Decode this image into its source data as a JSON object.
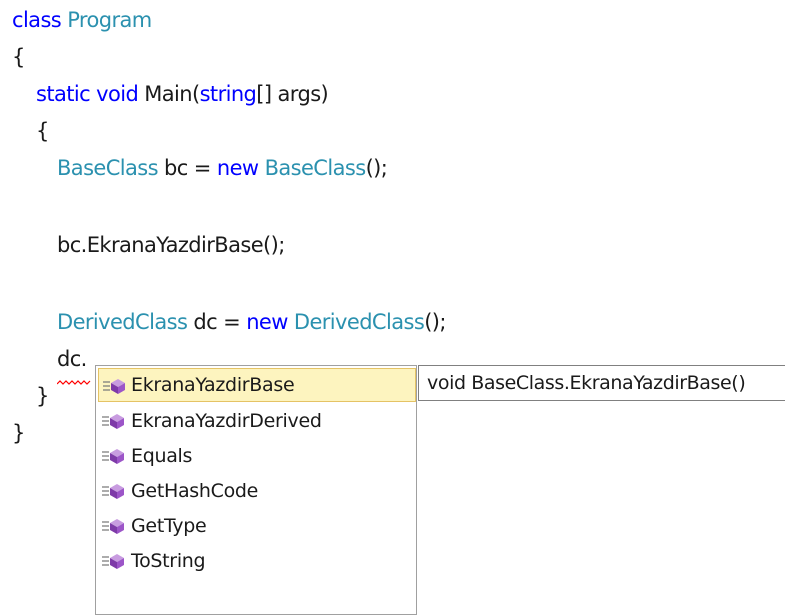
{
  "code": {
    "line1": {
      "keyword": "class",
      "name": "Program"
    },
    "line2": {
      "brace": "{"
    },
    "line3": {
      "kw1": "static",
      "kw2": "void",
      "name": "Main(",
      "param_type": "string",
      "rest": "[] args)"
    },
    "line4": {
      "brace": "{"
    },
    "line5": {
      "type": "BaseClass",
      "var": " bc = ",
      "kw": "new",
      "ctor": " BaseClass",
      "rest": "();"
    },
    "line6": {
      "text": "bc.EkranaYazdirBase();"
    },
    "line7": {
      "type": "DerivedClass",
      "var": " dc = ",
      "kw": "new",
      "ctor": " DerivedClass",
      "rest": "();"
    },
    "line8": {
      "text": "dc."
    },
    "line9": {
      "brace": "}"
    },
    "line10": {
      "brace": "}"
    }
  },
  "completion_list": {
    "items": [
      {
        "label": "EkranaYazdirBase",
        "icon": "method-icon",
        "selected": true
      },
      {
        "label": "EkranaYazdirDerived",
        "icon": "method-icon"
      },
      {
        "label": "Equals",
        "icon": "method-icon"
      },
      {
        "label": "GetHashCode",
        "icon": "method-icon"
      },
      {
        "label": "GetType",
        "icon": "method-icon"
      },
      {
        "label": "ToString",
        "icon": "method-icon"
      }
    ]
  },
  "tooltip": {
    "text": "void BaseClass.EkranaYazdirBase()"
  },
  "colors": {
    "keyword": "#0000ff",
    "type": "#2b91af",
    "selection_bg": "#fdf4bf",
    "selection_border": "#e5c365",
    "squiggle": "#ff0000",
    "method_icon": "#8a3fb5"
  }
}
